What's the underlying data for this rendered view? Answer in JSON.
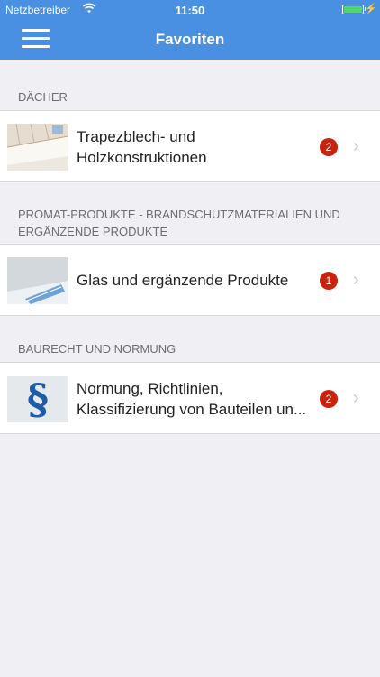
{
  "status": {
    "carrier": "Netzbetreiber",
    "time": "11:50"
  },
  "header": {
    "title": "Favoriten"
  },
  "sections": [
    {
      "title": "DÄCHER",
      "items": [
        {
          "label_line1": "Trapezblech- und",
          "label_line2": "Holzkonstruktionen",
          "badge": "2"
        }
      ]
    },
    {
      "title_line1": "PROMAT-PRODUKTE - BRANDSCHUTZMATERIALIEN UND",
      "title_line2": "ERGÄNZENDE PRODUKTE",
      "items": [
        {
          "label": "Glas und ergänzende Produkte",
          "badge": "1"
        }
      ]
    },
    {
      "title": "BAURECHT UND NORMUNG",
      "items": [
        {
          "label_line1": "Normung, Richtlinien,",
          "label_line2": "Klassifizierung von Bauteilen un...",
          "badge": "2"
        }
      ]
    }
  ],
  "colors": {
    "navbar": "#4a90e2",
    "badge": "#c9220d",
    "background": "#efeff4"
  },
  "icons": {
    "menu": "hamburger-icon",
    "chevron": "chevron-right-icon",
    "wifi": "wifi-icon",
    "battery": "battery-icon",
    "paragraph_glyph": "§"
  }
}
